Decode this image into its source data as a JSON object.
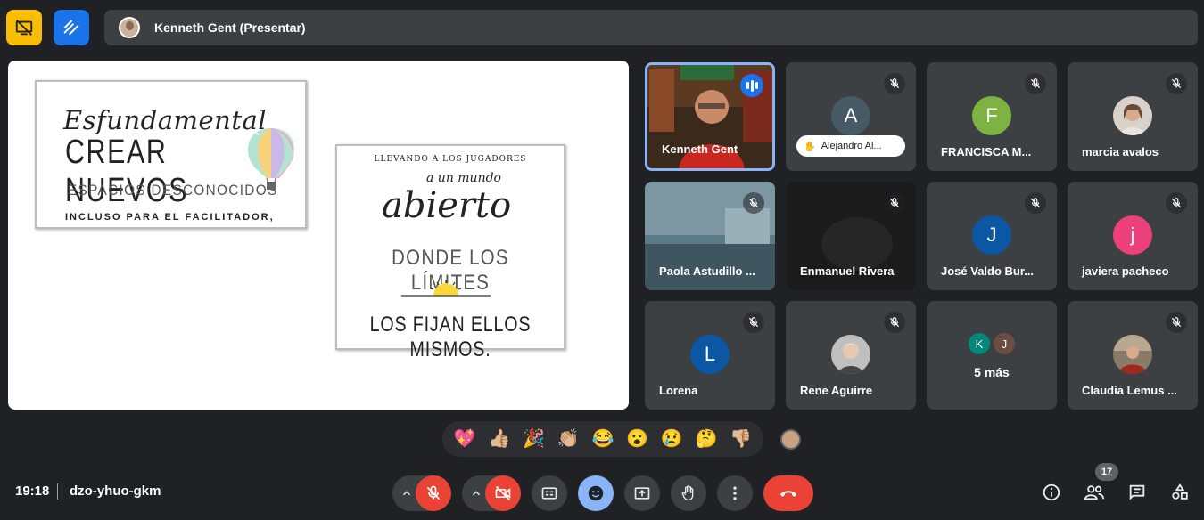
{
  "top_bar": {
    "presenter_label": "Kenneth Gent (Presentar)"
  },
  "slide": {
    "card1": {
      "line1": "Esfundamental",
      "line2": "CREAR NUEVOS",
      "line3": "ESPACIOS DESCONOCIDOS",
      "line4": "INCLUSO PARA EL FACILITADOR,"
    },
    "card2": {
      "line1": "LLEVANDO A LOS JUGADORES",
      "line2": "a un mundo",
      "line3": "abierto",
      "line4": "DONDE LOS LÍMITES",
      "line5": "LOS FIJAN ELLOS MISMOS."
    }
  },
  "participants": [
    {
      "name": "Kenneth Gent",
      "type": "video",
      "speaking": true
    },
    {
      "name": "Alejandro Al...",
      "type": "letter",
      "letter": "A",
      "color": "#455a64",
      "muted": true
    },
    {
      "name": "FRANCISCA M...",
      "type": "letter",
      "letter": "F",
      "color": "#7cb342",
      "muted": true
    },
    {
      "name": "marcia avalos",
      "type": "photo",
      "muted": true
    },
    {
      "name": "Paola Astudillo ...",
      "type": "video",
      "muted": true
    },
    {
      "name": "Enmanuel Rivera",
      "type": "video",
      "muted": true
    },
    {
      "name": "José Valdo Bur...",
      "type": "letter",
      "letter": "J",
      "color": "#0b57a4",
      "muted": true
    },
    {
      "name": "javiera pacheco",
      "type": "letter",
      "letter": "j",
      "color": "#ec407a",
      "muted": true
    },
    {
      "name": "Lorena",
      "type": "letter",
      "letter": "L",
      "color": "#0b57a4",
      "muted": true
    },
    {
      "name": "Rene Aguirre",
      "type": "photo",
      "muted": true
    },
    {
      "name": "5 más",
      "type": "more",
      "letters": [
        "K",
        "J"
      ],
      "colors": [
        "#00897b",
        "#6d4c41"
      ]
    },
    {
      "name": "Claudia Lemus ...",
      "type": "photo",
      "muted": true
    }
  ],
  "reactions": [
    "💖",
    "👍🏼",
    "🎉",
    "👏🏼",
    "😂",
    "😮",
    "😢",
    "🤔",
    "👎🏼"
  ],
  "bottom_bar": {
    "time": "19:18",
    "meeting_code": "dzo-yhuo-gkm",
    "participant_count": "17"
  },
  "colors": {
    "background": "#202124",
    "tile": "#3c4043",
    "danger": "#ea4335",
    "accent": "#8ab4f8"
  }
}
